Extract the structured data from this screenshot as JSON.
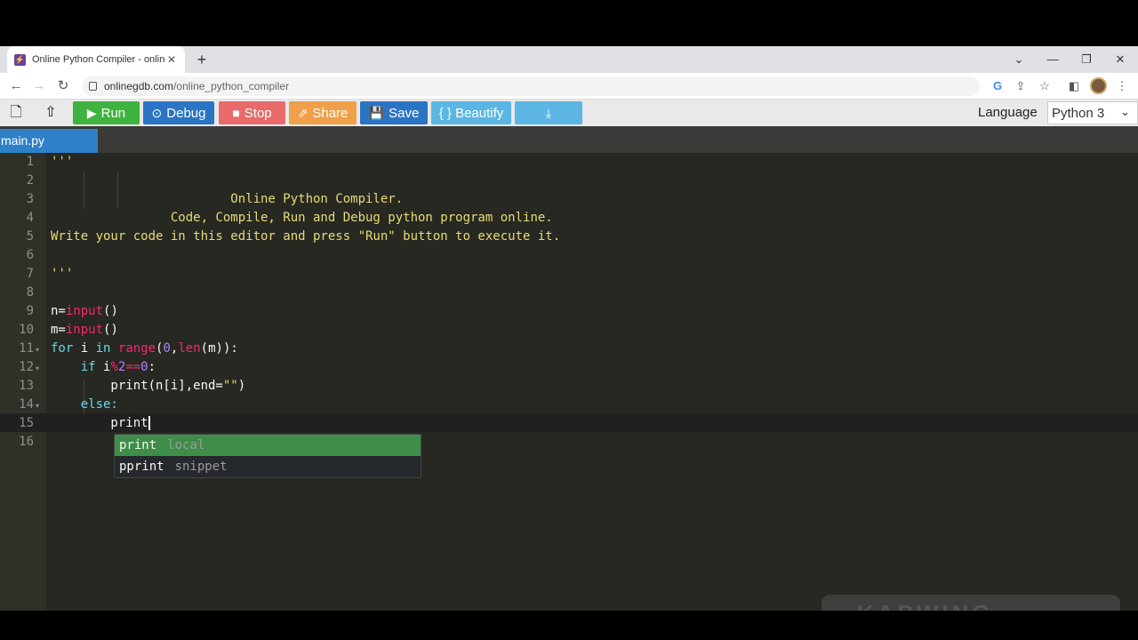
{
  "browser": {
    "tab_title": "Online Python Compiler - online",
    "new_tab": "+",
    "url_host": "onlinegdb.com",
    "url_path": "/online_python_compiler"
  },
  "toolbar": {
    "run_label": "Run",
    "debug_label": "Debug",
    "stop_label": "Stop",
    "share_label": "Share",
    "save_label": "Save",
    "beautify_label": "{ } Beautify",
    "language_label": "Language",
    "language_value": "Python 3",
    "colors": {
      "run": "#3fb33f",
      "debug": "#2b74c4",
      "stop": "#e86a6a",
      "share": "#f0a049",
      "save": "#2b74c4",
      "beautify": "#5bb6e4",
      "download": "#5bb6e4"
    }
  },
  "file_tab": "main.py",
  "editor": {
    "line_numbers": [
      "1",
      "2",
      "3",
      "4",
      "5",
      "6",
      "7",
      "8",
      "9",
      "10",
      "11",
      "12",
      "13",
      "14",
      "15",
      "16"
    ],
    "lines": {
      "l1": "'''",
      "l3": "                        Online Python Compiler.",
      "l4": "                Code, Compile, Run and Debug python program online.",
      "l5": "Write your code in this editor and press \"Run\" button to execute it.",
      "l7": "'''",
      "l9a": "n=",
      "l9b": "input",
      "l9c": "()",
      "l10a": "m=",
      "l10b": "input",
      "l10c": "()",
      "l11a": "for",
      "l11b": " i ",
      "l11c": "in",
      "l11d": " ",
      "l11e": "range",
      "l11f": "(",
      "l11g": "0",
      "l11h": ",",
      "l11i": "len",
      "l11j": "(m)):",
      "l12a": "    if",
      "l12b": " i",
      "l12c": "%",
      "l12d": "2",
      "l12e": "==",
      "l12f": "0",
      "l12g": ":",
      "l13a": "        print(n[i],end=",
      "l13b": "\"\"",
      "l13c": ")",
      "l14": "    else:",
      "l15": "        print"
    }
  },
  "autocomplete": {
    "items": [
      {
        "name": "print",
        "meta": "local"
      },
      {
        "name": "pprint",
        "meta": "snippet"
      }
    ]
  },
  "watermark": "KAPWING"
}
